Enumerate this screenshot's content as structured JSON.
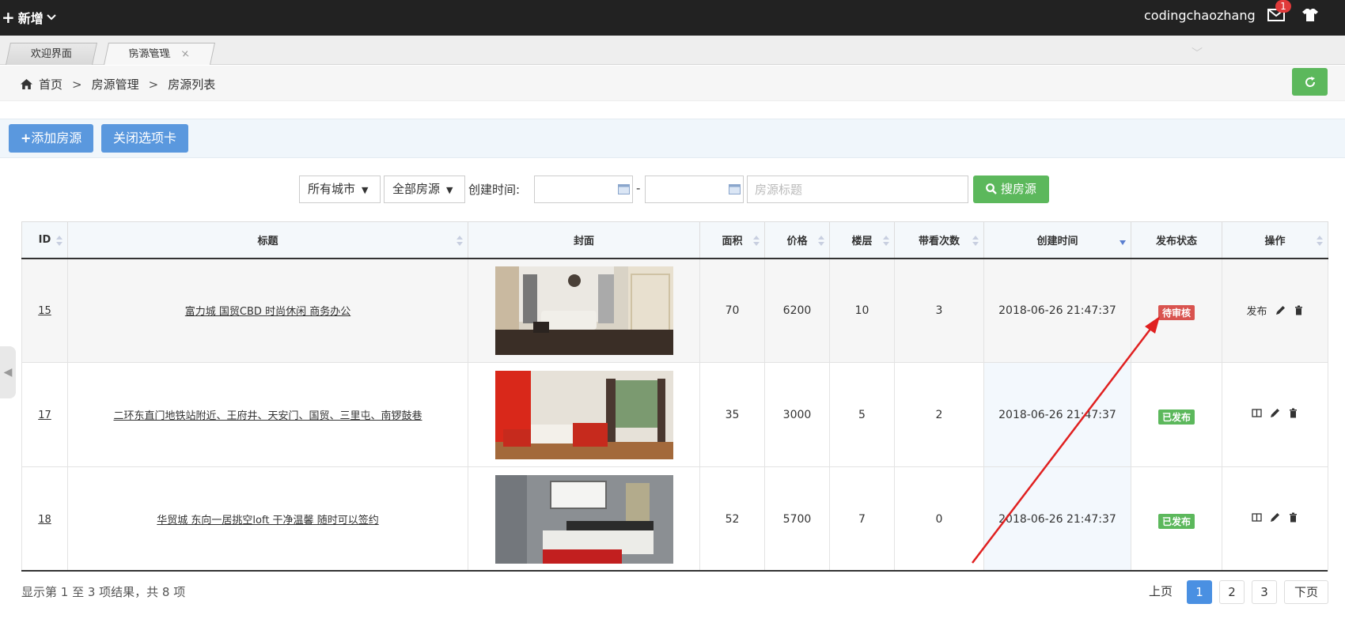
{
  "topbar": {
    "add_label": "新增",
    "username": "codingchaozhang",
    "mail_badge": "1"
  },
  "tabs": [
    {
      "label": "欢迎界面"
    },
    {
      "label": "房源管理",
      "close": "×"
    }
  ],
  "breadcrumb": {
    "home": "首页",
    "sep": ">",
    "items": [
      "房源管理",
      "房源列表"
    ]
  },
  "actions": {
    "add_house": "添加房源",
    "close_tab": "关闭选项卡"
  },
  "filters": {
    "city": "所有城市",
    "house_type": "全部房源",
    "created_label": "创建时间:",
    "date_sep": "-",
    "title_placeholder": "房源标题",
    "search_button": "搜房源"
  },
  "table": {
    "headers": [
      "ID",
      "标题",
      "封面",
      "面积",
      "价格",
      "楼层",
      "带看次数",
      "创建时间",
      "发布状态",
      "操作"
    ],
    "rows": [
      {
        "id": "15",
        "title": "富力城 国贸CBD 时尚休闲 商务办公",
        "area": "70",
        "price": "6200",
        "floor": "10",
        "watch": "3",
        "created": "2018-06-26 21:47:37",
        "status": "待审核",
        "status_color": "#d9534f",
        "publish": "发布"
      },
      {
        "id": "17",
        "title": "二环东直门地铁站附近、王府井、天安门、国贸、三里屯、南锣鼓巷",
        "area": "35",
        "price": "3000",
        "floor": "5",
        "watch": "2",
        "created": "2018-06-26 21:47:37",
        "status": "已发布",
        "status_color": "#5cb85c",
        "publish": ""
      },
      {
        "id": "18",
        "title": "华贸城 东向一居挑空loft 干净温馨 随时可以签约",
        "area": "52",
        "price": "5700",
        "floor": "7",
        "watch": "0",
        "created": "2018-06-26 21:47:37",
        "status": "已发布",
        "status_color": "#5cb85c",
        "publish": ""
      }
    ]
  },
  "footer": {
    "info": "显示第 1 至 3 项结果，共 8 项",
    "prev": "上页",
    "pages": [
      "1",
      "2",
      "3"
    ],
    "current_page": "1",
    "next": "下页"
  },
  "colors": {
    "accent_blue": "#5a98de",
    "success_green": "#5cb85c",
    "danger_red": "#d9534f",
    "annotation_arrow": "#e02020"
  }
}
